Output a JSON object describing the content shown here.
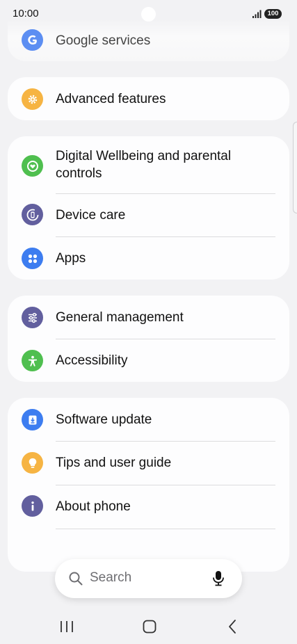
{
  "status_bar": {
    "time": "10:00",
    "battery": "100"
  },
  "top_item": {
    "label": "Google services",
    "icon": "google-icon",
    "color": "#4285f4"
  },
  "groups": [
    {
      "items": [
        {
          "label": "Advanced features",
          "icon": "gear-plus-icon",
          "color": "#f6b443"
        }
      ]
    },
    {
      "items": [
        {
          "label": "Digital Wellbeing and parental controls",
          "label_line1": "Digital Wellbeing and parental",
          "label_line2": "controls",
          "icon": "heart-ring-icon",
          "color": "#4fbf4f"
        },
        {
          "label": "Device care",
          "icon": "device-care-icon",
          "color": "#625f9e"
        },
        {
          "label": "Apps",
          "icon": "apps-dots-icon",
          "color": "#3d7df0"
        }
      ]
    },
    {
      "items": [
        {
          "label": "General management",
          "icon": "sliders-icon",
          "color": "#625f9e"
        },
        {
          "label": "Accessibility",
          "icon": "accessibility-person-icon",
          "color": "#4fbf4f"
        }
      ]
    },
    {
      "items": [
        {
          "label": "Software update",
          "icon": "download-box-icon",
          "color": "#3d7df0"
        },
        {
          "label": "Tips and user guide",
          "icon": "lightbulb-icon",
          "color": "#f6b443"
        },
        {
          "label": "About phone",
          "icon": "info-icon",
          "color": "#625f9e"
        }
      ]
    }
  ],
  "search": {
    "placeholder": "Search",
    "icon": "search-icon",
    "voice_icon": "microphone-icon"
  },
  "nav_bar": {
    "recents_icon": "recents-icon",
    "home_icon": "home-icon",
    "back_icon": "back-icon"
  }
}
